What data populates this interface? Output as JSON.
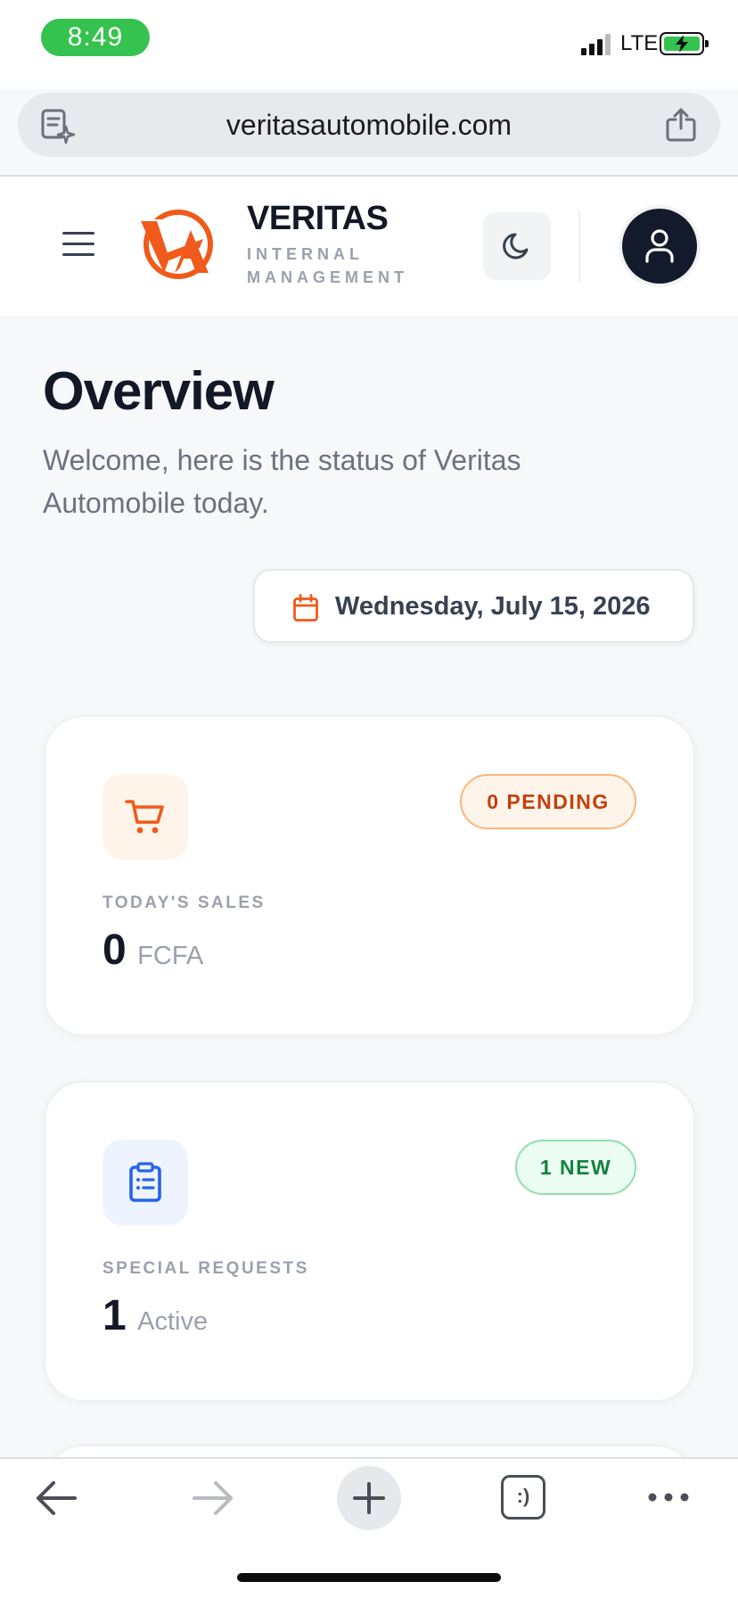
{
  "status_bar": {
    "time": "8:49",
    "network": "LTE",
    "battery_charging": true,
    "signal_bars": 3
  },
  "browser": {
    "url": "veritasautomobile.com",
    "left_icon": "page-sparkle-icon",
    "right_icon": "share-icon"
  },
  "header": {
    "brand_name": "VERITAS",
    "brand_tagline": "INTERNAL MANAGEMENT",
    "logo_letters": "VA",
    "theme_toggle_icon": "moon-icon",
    "account_icon": "user-icon"
  },
  "main": {
    "title": "Overview",
    "subtitle": "Welcome, here is the status of Veritas Automobile today.",
    "date": "Wednesday, July 15, 2026"
  },
  "cards": [
    {
      "icon": "cart-icon",
      "badge": "0 PENDING",
      "label": "TODAY'S SALES",
      "value": "0",
      "unit": "FCFA"
    },
    {
      "icon": "clipboard-list-icon",
      "badge": "1 NEW",
      "label": "SPECIAL REQUESTS",
      "value": "1",
      "unit": "Active"
    }
  ],
  "toolbar": {
    "items": [
      "back-icon",
      "forward-icon",
      "new-tab-icon",
      "tabs-icon",
      "more-icon"
    ],
    "tabs_label": ":)"
  },
  "colors": {
    "accent": "#f05a1a",
    "dark": "#121826",
    "muted": "#9aa1ad",
    "pending_badge": "#c2410c",
    "new_badge": "#15803d",
    "status_green": "#35c24f"
  }
}
